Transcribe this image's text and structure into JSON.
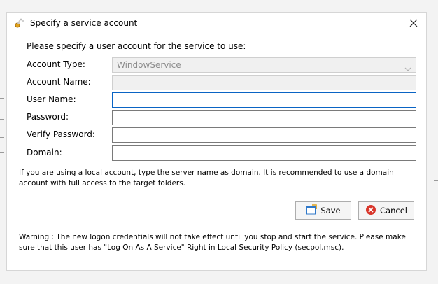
{
  "dialog": {
    "title": "Specify a service account",
    "prompt": "Please specify a user account for the service to use:",
    "close_icon": "close-icon"
  },
  "form": {
    "account_type": {
      "label": "Account Type:",
      "value": "WindowService",
      "disabled": true
    },
    "account_name": {
      "label": "Account Name:",
      "value": "",
      "disabled": true
    },
    "user_name": {
      "label": "User Name:",
      "value": "",
      "focused": true
    },
    "password": {
      "label": "Password:",
      "value": ""
    },
    "verify_password": {
      "label": "Verify Password:",
      "value": ""
    },
    "domain": {
      "label": "Domain:",
      "value": ""
    }
  },
  "info_text": "If you are using a local account, type the server name as domain. It is recommended to use a domain account with full access to the target folders.",
  "buttons": {
    "save_label": "Save",
    "save_icon": "save-icon",
    "cancel_label": "Cancel",
    "cancel_icon": "cancel-icon"
  },
  "warning_text": "Warning : The new logon credentials will not take effect until you stop and start the service. Please make sure that this user has \"Log On As A Service\" Right in Local Security Policy (secpol.msc).",
  "colors": {
    "focus_border": "#0a64c4",
    "cancel_icon": "#d9362b",
    "save_icon": "#2f78c9"
  }
}
